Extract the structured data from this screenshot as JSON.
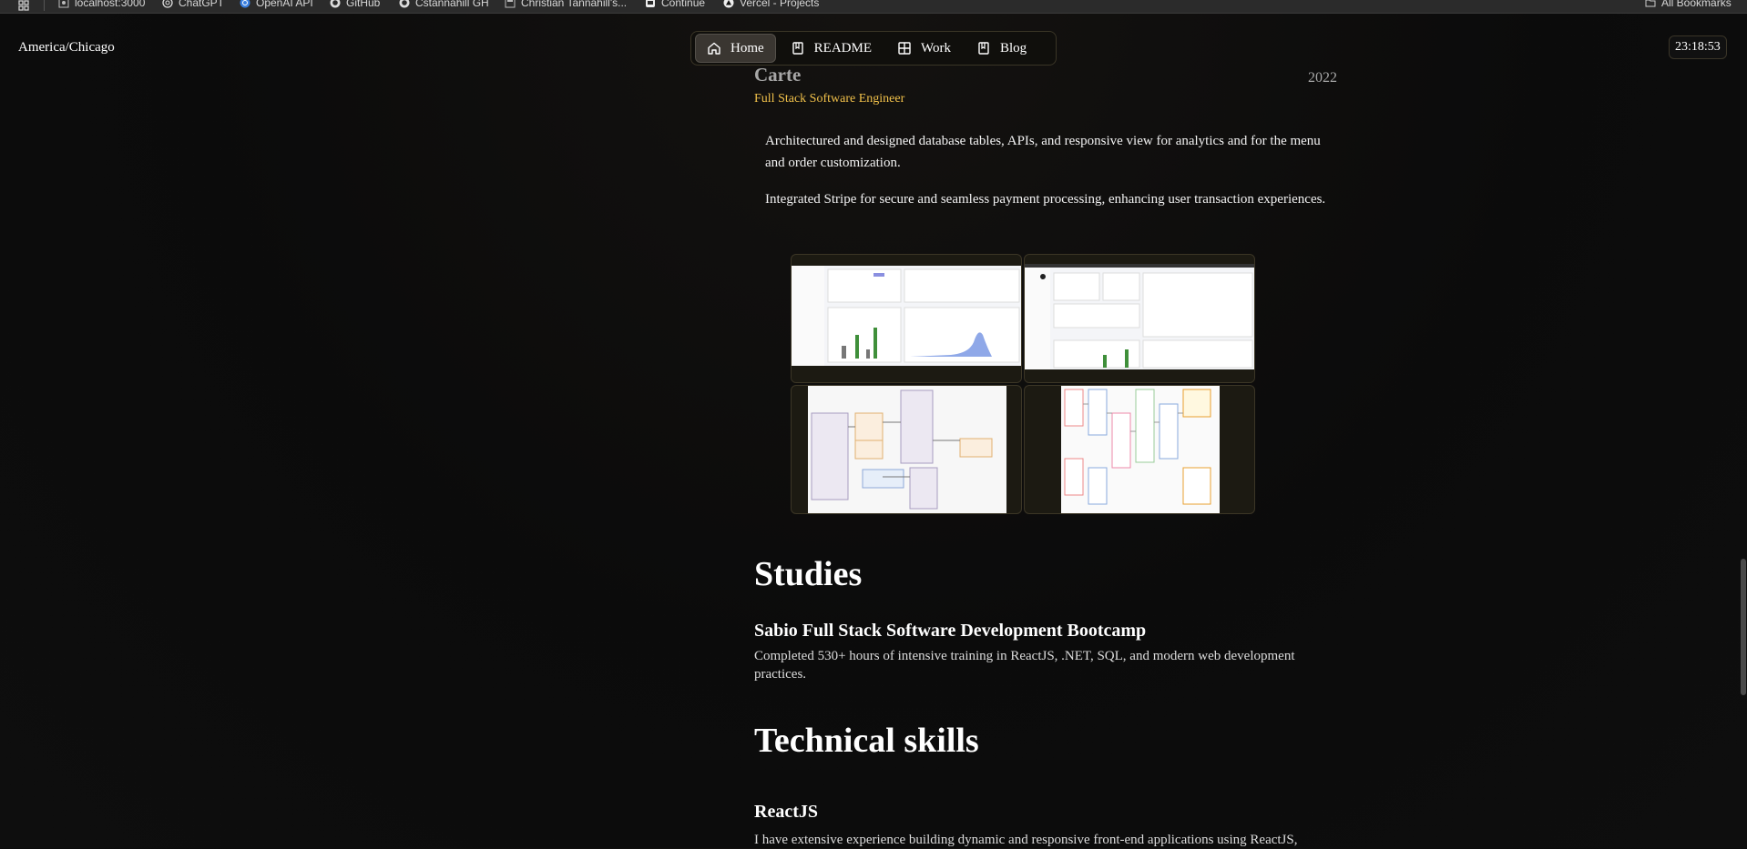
{
  "bookmarks": {
    "items": [
      {
        "label": "localhost:3000",
        "icon": "globe-icon"
      },
      {
        "label": "ChatGPT",
        "icon": "openai-icon"
      },
      {
        "label": "OpenAI API",
        "icon": "openai-icon"
      },
      {
        "label": "GitHub",
        "icon": "github-icon"
      },
      {
        "label": "Cstannahill GH",
        "icon": "github-icon"
      },
      {
        "label": "Christian Tannahill's...",
        "icon": "page-icon"
      },
      {
        "label": "Continue",
        "icon": "page-icon"
      },
      {
        "label": "Vercel - Projects",
        "icon": "vercel-icon"
      }
    ],
    "all_bookmarks": "All Bookmarks"
  },
  "header": {
    "timezone": "America/Chicago",
    "clock": "23:18:53",
    "nav": [
      {
        "label": "Home",
        "icon": "home-icon",
        "active": true
      },
      {
        "label": "README",
        "icon": "book-icon",
        "active": false
      },
      {
        "label": "Work",
        "icon": "grid-icon",
        "active": false
      },
      {
        "label": "Blog",
        "icon": "book-icon",
        "active": false
      }
    ]
  },
  "experience": {
    "company": "Carte",
    "year": "2022",
    "role": "Full Stack Software Engineer",
    "bullets": [
      "Architectured and designed database tables, APIs, and responsive view for analytics and for the menu and order customization.",
      "Integrated Stripe for secure and seamless payment processing, enhancing user transaction experiences."
    ]
  },
  "studies": {
    "heading": "Studies",
    "course_title": "Sabio Full Stack Software Development Bootcamp",
    "course_desc": "Completed 530+ hours of intensive training in ReactJS, .NET, SQL, and modern web development practices."
  },
  "skills": {
    "heading": "Technical skills",
    "first_title": "ReactJS",
    "first_desc": "I have extensive experience building dynamic and responsive front-end applications using ReactJS,"
  },
  "colors": {
    "accent": "#f0c04a",
    "bar_green": "#3f8f3a",
    "chart_blue": "#8fa8e8"
  }
}
